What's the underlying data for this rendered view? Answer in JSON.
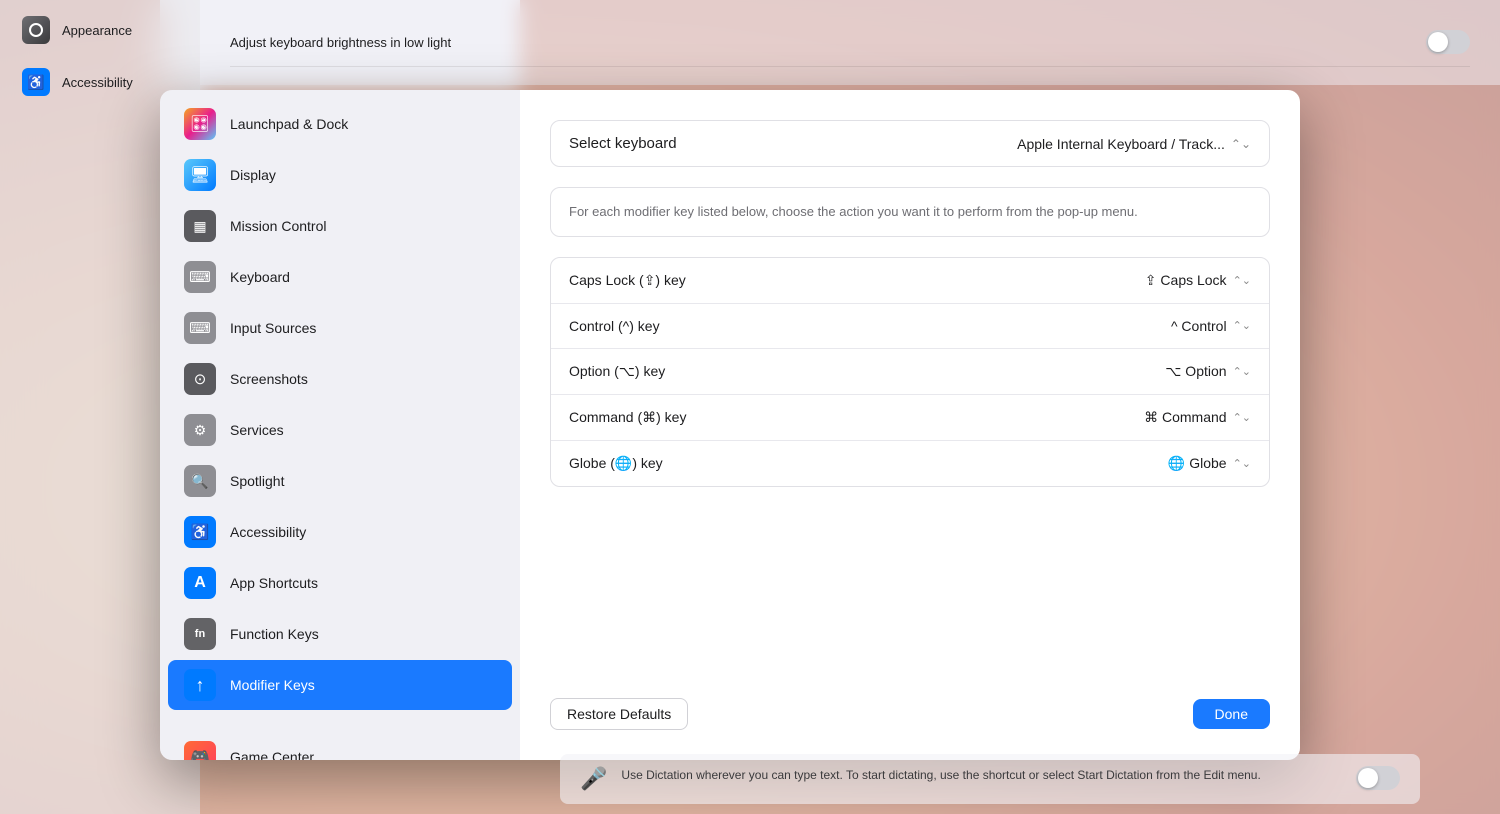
{
  "background": {
    "top_setting": "Adjust keyboard brightness in low light",
    "bottom_setting": "Use Dictation wherever you can type text. To start dictating, use the shortcut or select Start Dictation from the Edit menu."
  },
  "sidebar": {
    "items": [
      {
        "id": "launchpad",
        "label": "Launchpad & Dock",
        "icon": "🎛️",
        "icon_class": "icon-launchpad"
      },
      {
        "id": "display",
        "label": "Display",
        "icon": "🖥️",
        "icon_class": "icon-display"
      },
      {
        "id": "mission",
        "label": "Mission Control",
        "icon": "▦",
        "icon_class": "icon-mission"
      },
      {
        "id": "keyboard",
        "label": "Keyboard",
        "icon": "⌨",
        "icon_class": "icon-keyboard"
      },
      {
        "id": "input-sources",
        "label": "Input Sources",
        "icon": "⌨",
        "icon_class": "icon-input-sources"
      },
      {
        "id": "screenshots",
        "label": "Screenshots",
        "icon": "⊙",
        "icon_class": "icon-screenshots"
      },
      {
        "id": "services",
        "label": "Services",
        "icon": "⚙",
        "icon_class": "icon-services"
      },
      {
        "id": "spotlight",
        "label": "Spotlight",
        "icon": "🔍",
        "icon_class": "icon-spotlight"
      },
      {
        "id": "accessibility",
        "label": "Accessibility",
        "icon": "♿",
        "icon_class": "icon-accessibility"
      },
      {
        "id": "app-shortcuts",
        "label": "App Shortcuts",
        "icon": "A",
        "icon_class": "icon-app-shortcuts"
      },
      {
        "id": "fn",
        "label": "Function Keys",
        "icon": "fn",
        "icon_class": "icon-fn"
      },
      {
        "id": "modifier",
        "label": "Modifier Keys",
        "icon": "↑",
        "icon_class": "icon-modifier",
        "active": true
      }
    ],
    "bottom_items": [
      {
        "id": "game-center",
        "label": "Game Center",
        "icon": "🎮",
        "icon_class": "icon-game-center"
      }
    ]
  },
  "main": {
    "select_keyboard_label": "Select keyboard",
    "select_keyboard_value": "Apple Internal Keyboard / Track...",
    "description": "For each modifier key listed below, choose the action you want it to perform from the pop-up menu.",
    "modifier_keys": [
      {
        "key": "Caps Lock (⇪) key",
        "value": "⇪ Caps Lock"
      },
      {
        "key": "Control (^) key",
        "value": "^ Control"
      },
      {
        "key": "Option (⌥) key",
        "value": "⌥ Option"
      },
      {
        "key": "Command (⌘) key",
        "value": "⌘ Command"
      },
      {
        "key": "Globe (🌐) key",
        "value": "🌐 Globe"
      }
    ],
    "restore_defaults_label": "Restore Defaults",
    "done_label": "Done"
  },
  "bg_sidebar_items": [
    {
      "label": "Appearance",
      "icon": "○"
    },
    {
      "label": "Accessibility",
      "icon": "♿"
    }
  ]
}
